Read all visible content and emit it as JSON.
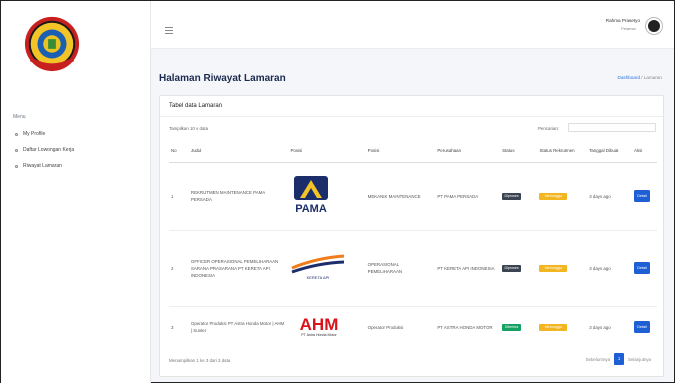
{
  "sidebar": {
    "menu_label": "Menu",
    "items": [
      {
        "label": "My Profile"
      },
      {
        "label": "Daftar Lowongan Kerja"
      },
      {
        "label": "Riwayat Lamaran"
      }
    ]
  },
  "topbar": {
    "user_name": "Rahma Prasetyo",
    "user_role": "Pelamar"
  },
  "page": {
    "title": "Halaman Riwayat Lamaran",
    "breadcrumb_home": "Dashboard",
    "breadcrumb_current": "Lamaran"
  },
  "card": {
    "title": "Tabel data Lamaran",
    "length_text": "Tampilkan 10 v data",
    "search_label": "Pencarian:",
    "search_value": ""
  },
  "table": {
    "headers": [
      "No",
      "Judul",
      "Posisi",
      "Posisi",
      "Perusahaan",
      "Status",
      "Status Rekrutmen",
      "Tanggal Dibuat",
      "Aksi"
    ],
    "rows": [
      {
        "no": "1",
        "judul": "REKRUTMEN MAINTENANCE PAMA PERSADA",
        "logo_text": "PAMA",
        "posisi": "MEKANIK MAINTENANCE",
        "perusahaan": "PT PAMA PERSADA",
        "status": "Diproses",
        "rekrutmen": "Menunggu",
        "tanggal": "3 days ago",
        "aksi": "Detail"
      },
      {
        "no": "2",
        "judul": "OFFICER OPERASIONAL PEMELIHARAAN SARANA PRASARANA PT KERETA API INDONESIA",
        "logo_text": "KERETA API",
        "posisi": "OPERASIONAL PEMELIHARAAN",
        "perusahaan": "PT KERETA API INDONESIA",
        "status": "Diproses",
        "rekrutmen": "Menunggu",
        "tanggal": "3 days ago",
        "aksi": "Detail"
      },
      {
        "no": "3",
        "judul": "Operator Produksi PT Astra Honda Motor | AHM | Sunter",
        "logo_text": "AHM",
        "logo_sub": "PT Astra Honda Motor",
        "posisi": "Operator Produksi",
        "perusahaan": "PT ASTRA HONDA MOTOR",
        "status": "Diterima",
        "rekrutmen": "Menunggu",
        "tanggal": "3 days ago",
        "aksi": "Detail"
      }
    ]
  },
  "footer": {
    "info": "Menampilkan 1 ke 3 dari 3 data",
    "prev": "Sebelumnya",
    "page": "1",
    "next": "Selanjutnya"
  },
  "colors": {
    "primary": "#1f5fd6",
    "warning": "#f2b620",
    "success": "#17a063",
    "dark": "#3c4452"
  }
}
